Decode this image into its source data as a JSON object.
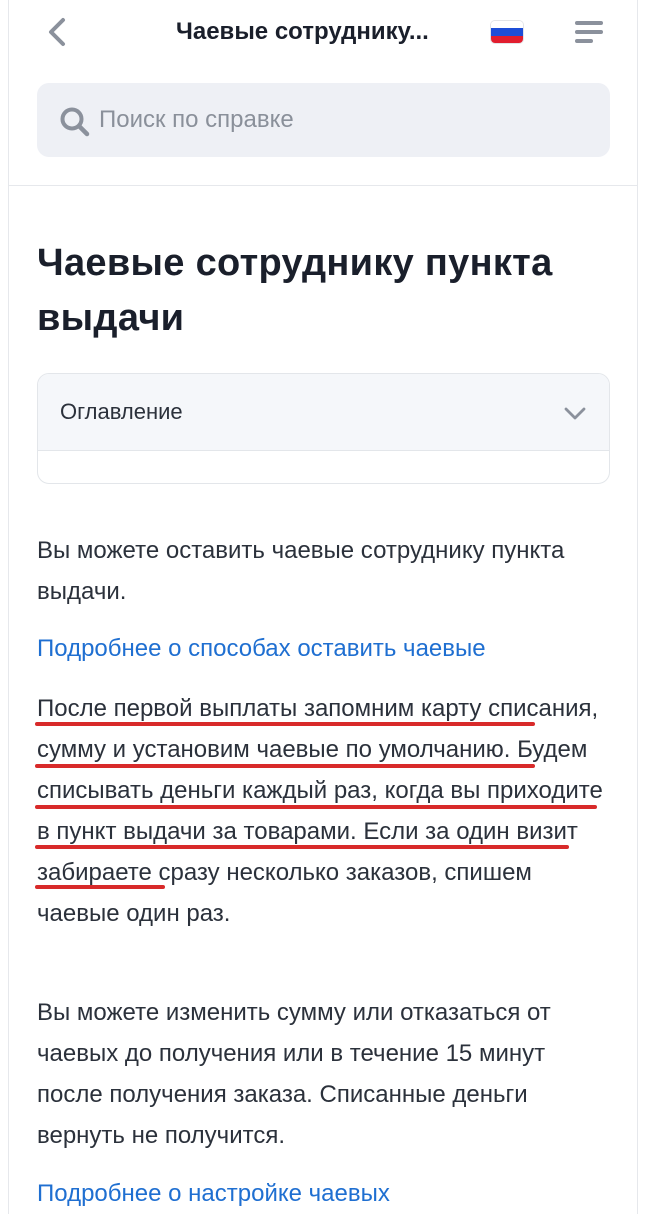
{
  "header": {
    "title": "Чаевые сотруднику...",
    "back_icon": "chevron-left-icon",
    "menu_icon": "hamburger-icon",
    "flag_icon": "russia-flag-icon",
    "flag_colors": [
      "#ffffff",
      "#1d4ed8",
      "#e11d2e"
    ]
  },
  "search": {
    "placeholder": "Поиск по справке",
    "icon": "search-icon"
  },
  "article": {
    "title": "Чаевые сотруднику пункта выдачи",
    "toc": {
      "label": "Оглавление",
      "icon": "chevron-down-icon"
    },
    "paragraph_1": "Вы можете оставить чаевые сотруднику пункта выдачи.",
    "link_1": "Подробнее о способах оставить чаевые",
    "paragraph_2_highlighted": "После первой выплаты запомним карту списания, сумму и установим чаевые по умолчанию. Будем списывать деньги каждый раз, когда вы приходите в пункт выдачи за товарами.",
    "paragraph_2_rest": "Если за один визит забираете сразу несколько заказов, спишем чаевые один раз.",
    "paragraph_3": "Вы можете изменить сумму или отказаться от чаевых до получения или в течение 15 минут после получения заказа. Списанные деньги вернуть не получится.",
    "link_2": "Подробнее о настройке чаевых"
  },
  "colors": {
    "link": "#1f6fd1",
    "highlight_underline": "#d82a2a",
    "search_bg": "#eef0f5"
  }
}
